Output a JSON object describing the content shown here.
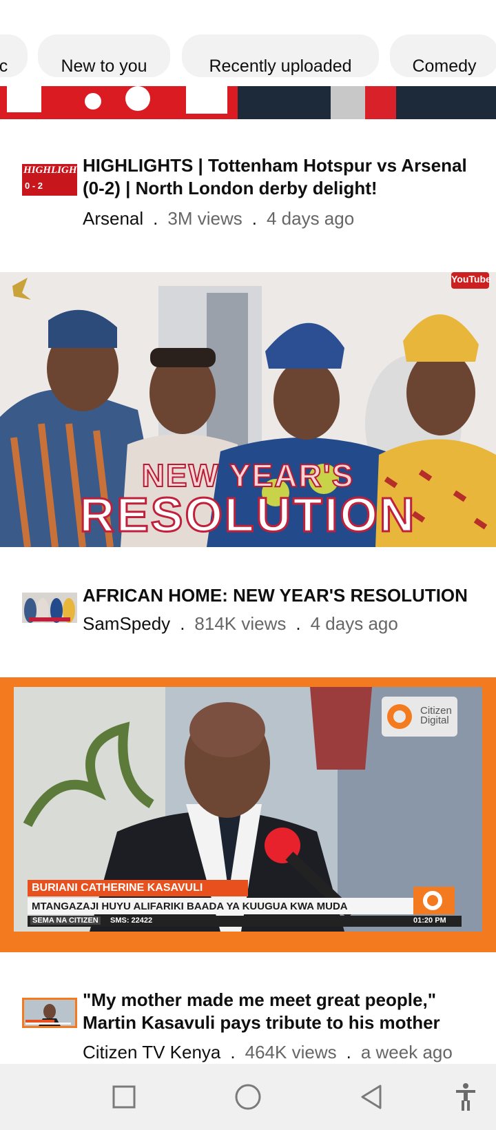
{
  "chips": [
    {
      "label": "c"
    },
    {
      "label": "New to you"
    },
    {
      "label": "Recently uploaded"
    },
    {
      "label": "Comedy"
    }
  ],
  "videos": [
    {
      "title": "HIGHLIGHTS | Tottenham Hotspur vs Arsenal (0-2) | North London derby delight!",
      "channel": "Arsenal",
      "views": "3M views",
      "age": "4 days ago",
      "thumb_text": "",
      "avatar_text": "HIGHLIGHTS",
      "avatar_score": "0 - 2"
    },
    {
      "title": "AFRICAN HOME: NEW YEAR'S RESOLUTION",
      "channel": "SamSpedy",
      "views": "814K views",
      "age": "4 days ago",
      "thumb_line1": "NEW YEAR'S",
      "thumb_line2": "RESOLUTION",
      "thumb_badge": "YouTube"
    },
    {
      "title": "\"My mother made me meet great people,\" Martin Kasavuli pays tribute to his mother",
      "channel": "Citizen TV Kenya",
      "views": "464K views",
      "age": "a week ago",
      "ticker_title": "BURIANI CATHERINE KASAVULI",
      "ticker_text": "MTANGAZAJI HUYU ALIFARIKI BAADA YA KUUGUA KWA MUDA",
      "ticker_bottom_left": "SEMA NA CITIZEN",
      "ticker_sms": "SMS: 22422",
      "ticker_time": "01:20 PM",
      "logo_line1": "Citizen",
      "logo_line2": "Digital"
    }
  ],
  "colors": {
    "arsenal_red": "#db1b22",
    "citizen_orange": "#f47a20",
    "nav_bg": "#f0f0f0"
  },
  "navbar": [
    "recents-icon",
    "home-icon",
    "back-icon",
    "accessibility-icon"
  ]
}
